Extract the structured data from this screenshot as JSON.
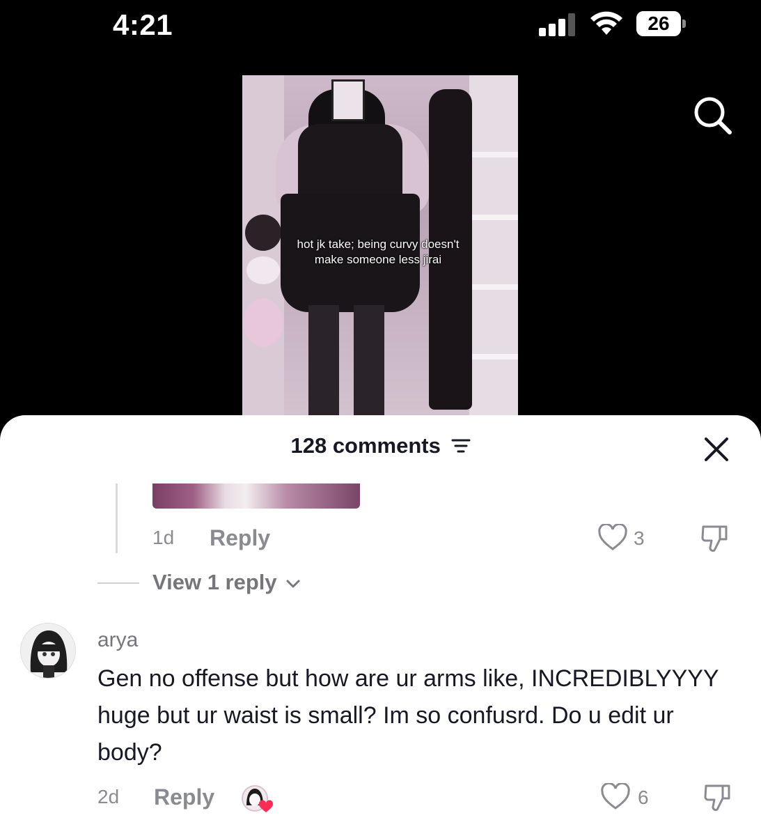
{
  "status_bar": {
    "time": "4:21",
    "battery": "26"
  },
  "video": {
    "caption": "hot jk take; being curvy doesn't make someone less jirai"
  },
  "comments_sheet": {
    "title": "128 comments",
    "reply_item": {
      "age": "1d",
      "reply_label": "Reply",
      "likes": "3"
    },
    "view_replies": "View 1 reply",
    "comment": {
      "username": "arya",
      "text": "Gen no offense but how are ur arms like, INCREDIBLYYYY huge but ur waist is small? Im so confusrd. Do u edit ur body?",
      "age": "2d",
      "reply_label": "Reply",
      "likes": "6"
    }
  },
  "icons": {
    "search": "search-icon",
    "sort": "sort-icon",
    "close": "close-icon",
    "heart": "heart-icon",
    "dislike": "thumbs-down-icon",
    "chevron": "chevron-down-icon"
  }
}
